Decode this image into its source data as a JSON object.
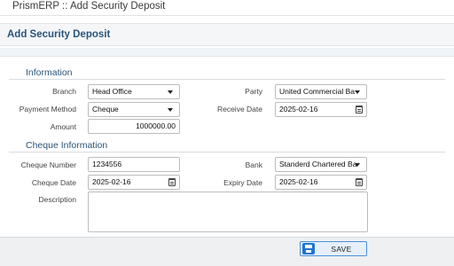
{
  "window": {
    "title": "PrismERP :: Add Security Deposit"
  },
  "page": {
    "title": "Add Security Deposit"
  },
  "information": {
    "section_title": "Information",
    "branch": {
      "label": "Branch",
      "value": "Head Office"
    },
    "party": {
      "label": "Party",
      "value": "United Commercial Ba"
    },
    "payment_method": {
      "label": "Payment Method",
      "value": "Cheque"
    },
    "receive_date": {
      "label": "Receive Date",
      "value": "2025-02-16"
    },
    "amount": {
      "label": "Amount",
      "value": "1000000.00"
    }
  },
  "cheque": {
    "section_title": "Cheque Information",
    "cheque_number": {
      "label": "Cheque Number",
      "value": "1234556"
    },
    "bank": {
      "label": "Bank",
      "value": "Standerd Chartered Ba"
    },
    "cheque_date": {
      "label": "Cheque Date",
      "value": "2025-02-16"
    },
    "expiry_date": {
      "label": "Expiry Date",
      "value": "2025-02-16"
    },
    "description": {
      "label": "Description",
      "value": ""
    }
  },
  "footer": {
    "save_label": "SAVE"
  },
  "icons": {
    "dropdown": "chevron-down-icon",
    "calendar": "calendar-icon",
    "save": "save-icon"
  }
}
